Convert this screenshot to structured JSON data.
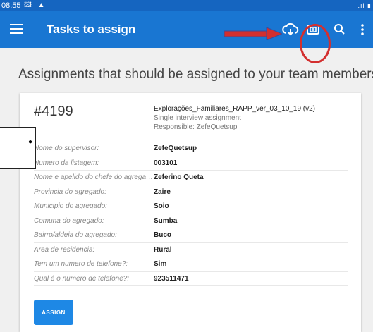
{
  "statusbar": {
    "time": "08:55",
    "icons": "🖾 ▲",
    "right": ".ıl ▮"
  },
  "appbar": {
    "title": "Tasks to assign",
    "actions": [
      "cloud-sync-icon",
      "scan-icon",
      "search-icon",
      "more-vert-icon"
    ]
  },
  "page": {
    "heading": "Assignments that should be assigned to your team members"
  },
  "card": {
    "id": "#4199",
    "questionnaire": "Explorações_Familiares_RAPP_ver_03_10_19 (v2)",
    "type": "Single interview assignment",
    "responsible": "Responsible: ZefeQuetsup",
    "rows": [
      {
        "label": "Nome do supervisor:",
        "value": "ZefeQuetsup"
      },
      {
        "label": "Numero da listagem:",
        "value": "003101"
      },
      {
        "label": "Nome e apelido do chefe do agregado:",
        "value": "Zeferino Queta"
      },
      {
        "label": "Provincia do agregado:",
        "value": "Zaire"
      },
      {
        "label": "Municipio do agregado:",
        "value": "Soio"
      },
      {
        "label": "Comuna do agregado:",
        "value": "Sumba"
      },
      {
        "label": "Bairro/aldeia do agregado:",
        "value": "Buco"
      },
      {
        "label": "Area de residencia:",
        "value": "Rural"
      },
      {
        "label": "Tem um numero de telefone?:",
        "value": "Sim"
      },
      {
        "label": "Qual é o numero de telefone?:",
        "value": "923511471"
      }
    ],
    "assign_label": "ASSIGN"
  },
  "colors": {
    "appbar": "#1976d2",
    "statusbar": "#1565c0",
    "accent": "#1e88e5",
    "annotation": "#d32f2f"
  }
}
